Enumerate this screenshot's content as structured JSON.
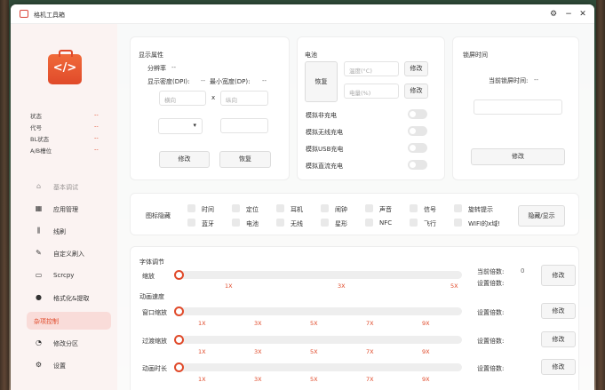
{
  "window": {
    "title": "格机工具箱",
    "settings_icon": "gear-icon",
    "minimize": "−",
    "close": "✕"
  },
  "sidebar": {
    "logo_glyph": "</>",
    "info": [
      {
        "label": "状态",
        "value": "--"
      },
      {
        "label": "代号",
        "value": "--"
      },
      {
        "label": "BL状态",
        "value": "--"
      },
      {
        "label": "A/B槽位",
        "value": "--"
      }
    ],
    "nav": [
      {
        "label": "基本调试",
        "icon": "home-icon"
      },
      {
        "label": "应用管理",
        "icon": "grid-icon"
      },
      {
        "label": "线刷",
        "icon": "flash-icon"
      },
      {
        "label": "自定义刷入",
        "icon": "edit-icon"
      },
      {
        "label": "Scrcpy",
        "icon": "monitor-icon"
      },
      {
        "label": "格式化&提取",
        "icon": "user-icon"
      },
      {
        "label": "杂项控制",
        "icon": "misc-icon"
      },
      {
        "label": "修改分区",
        "icon": "partition-icon"
      },
      {
        "label": "设置",
        "icon": "settings-icon"
      }
    ],
    "active": "杂项控制"
  },
  "display": {
    "heading": "显示属性",
    "resolution_label": "分辨率",
    "resolution_value": "--",
    "dpi_label": "显示密度(DPI):",
    "dpi_value": "--",
    "min_width_label": "最小宽度(DP):",
    "min_width_value": "--",
    "width_placeholder": "横向",
    "x_sep": "x",
    "height_placeholder": "纵向",
    "modify": "修改",
    "restore": "恢复"
  },
  "battery": {
    "heading": "电池",
    "restore": "恢复",
    "temp_placeholder": "温度(°C)",
    "level_placeholder": "电量(%)",
    "modify1": "修改",
    "modify2": "修改",
    "toggles": [
      "模拟非充电",
      "模拟无线充电",
      "模拟USB充电",
      "模拟直流充电"
    ]
  },
  "lock": {
    "heading": "锁屏时间",
    "current_label": "当前锁屏时间:",
    "current_value": "--",
    "modify": "修改"
  },
  "icons_hide": {
    "label": "图标隐藏",
    "row1": [
      "时间",
      "定位",
      "耳机",
      "闹钟",
      "声音",
      "信号",
      "旋转提示"
    ],
    "row2": [
      "蓝牙",
      "电池",
      "无线",
      "星形",
      "NFC",
      "飞行",
      "WIFI的x域!"
    ],
    "button": "隐藏/显示"
  },
  "font": {
    "heading": "字体调节",
    "scale_label": "缩放",
    "ticks": [
      "1X",
      "3X",
      "5X"
    ],
    "current_label": "当前倍数:",
    "current_value": "0",
    "set_label": "设置倍数:",
    "modify": "修改"
  },
  "anim": {
    "heading": "动画速度",
    "rows": [
      {
        "label": "窗口缩放",
        "set_label": "设置倍数:",
        "modify": "修改"
      },
      {
        "label": "过渡缩放",
        "set_label": "设置倍数:",
        "modify": "修改"
      },
      {
        "label": "动画时长",
        "set_label": "设置倍数:",
        "modify": "修改"
      }
    ],
    "ticks": [
      "1X",
      "3X",
      "5X",
      "7X",
      "9X"
    ]
  }
}
